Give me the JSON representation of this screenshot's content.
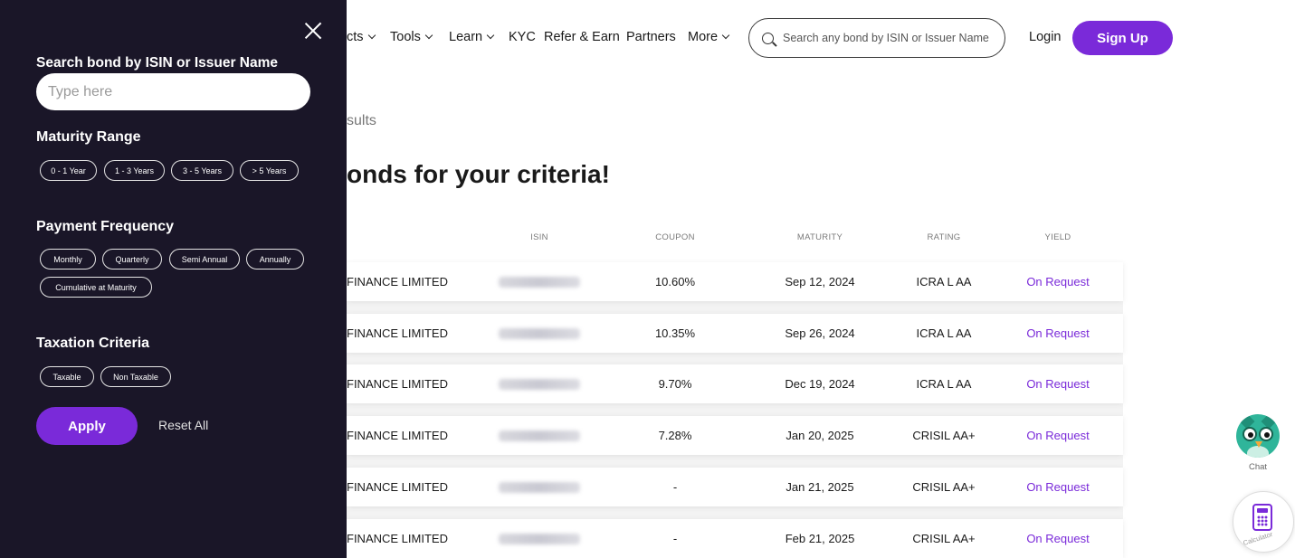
{
  "nav": {
    "items": [
      {
        "label": "cts",
        "has_dropdown": true
      },
      {
        "label": "Tools",
        "has_dropdown": true
      },
      {
        "label": "Learn",
        "has_dropdown": true
      },
      {
        "label": "KYC",
        "has_dropdown": false
      },
      {
        "label": "Refer & Earn",
        "has_dropdown": false
      },
      {
        "label": "Partners",
        "has_dropdown": false
      },
      {
        "label": "More",
        "has_dropdown": true
      }
    ],
    "search_placeholder": "Search any bond by ISIN or Issuer Name",
    "login_label": "Login",
    "signup_label": "Sign Up"
  },
  "results": {
    "crumb": "sults",
    "heading": "onds for your criteria!"
  },
  "table": {
    "headers": {
      "isin": "ISIN",
      "coupon": "COUPON",
      "maturity": "MATURITY",
      "rating": "RATING",
      "yield": "YIELD"
    },
    "rows": [
      {
        "issuer": "FINANCE LIMITED",
        "coupon": "10.60%",
        "maturity": "Sep 12, 2024",
        "rating": "ICRA L AA",
        "yield": "On Request"
      },
      {
        "issuer": "FINANCE LIMITED",
        "coupon": "10.35%",
        "maturity": "Sep 26, 2024",
        "rating": "ICRA L AA",
        "yield": "On Request"
      },
      {
        "issuer": "FINANCE LIMITED",
        "coupon": "9.70%",
        "maturity": "Dec 19, 2024",
        "rating": "ICRA L AA",
        "yield": "On Request"
      },
      {
        "issuer": "FINANCE LIMITED",
        "coupon": "7.28%",
        "maturity": "Jan 20, 2025",
        "rating": "CRISIL AA+",
        "yield": "On Request"
      },
      {
        "issuer": "FINANCE LIMITED",
        "coupon": "-",
        "maturity": "Jan 21, 2025",
        "rating": "CRISIL AA+",
        "yield": "On Request"
      },
      {
        "issuer": "FINANCE LIMITED",
        "coupon": "-",
        "maturity": "Feb 21, 2025",
        "rating": "CRISIL AA+",
        "yield": "On Request"
      }
    ]
  },
  "sidebar": {
    "search_label": "Search bond by ISIN or Issuer Name",
    "search_placeholder": "Type here",
    "maturity": {
      "label": "Maturity Range",
      "options": [
        "0 - 1 Year",
        "1 - 3 Years",
        "3 - 5 Years",
        "> 5 Years"
      ]
    },
    "payment": {
      "label": "Payment Frequency",
      "options": [
        "Monthly",
        "Quarterly",
        "Semi Annual",
        "Annually",
        "Cumulative at Maturity"
      ]
    },
    "taxation": {
      "label": "Taxation Criteria",
      "options": [
        "Taxable",
        "Non Taxable"
      ]
    },
    "apply_label": "Apply",
    "reset_label": "Reset All"
  },
  "widgets": {
    "chat_label": "Chat",
    "calculator_label": "Calculator"
  },
  "colors": {
    "accent": "#7a2ad9",
    "sidebar_bg": "#1a1628"
  }
}
